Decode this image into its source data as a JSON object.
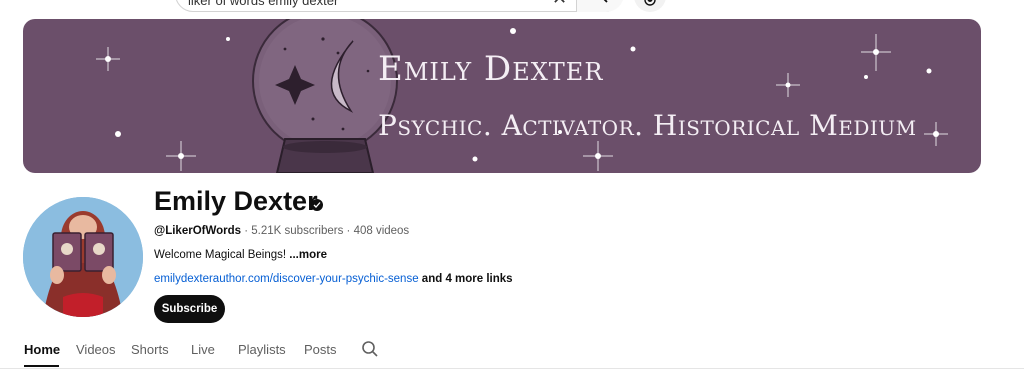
{
  "search": {
    "query": "liker of words emily dexter",
    "clear_icon": "close-icon",
    "button_icon": "search-icon",
    "mic_icon": "mic-icon"
  },
  "banner": {
    "title": "Emily Dexter",
    "subtitle": "Psychic. Activator. Historical Medium",
    "background_color": "#6b4f6a"
  },
  "channel": {
    "name": "Emily Dexter",
    "verified_icon": "verified-check-icon",
    "handle": "@LikerOfWords",
    "subscribers": "5.21K subscribers",
    "videos": "408 videos",
    "separator": " · ",
    "description": "Welcome Magical Beings! ",
    "more_label": "...more",
    "link": "emilydexterauthor.com/discover-your-psychic-sense",
    "more_links": " and 4 more links",
    "subscribe_label": "Subscribe"
  },
  "tabs": [
    {
      "label": "Home",
      "active": true
    },
    {
      "label": "Videos",
      "active": false
    },
    {
      "label": "Shorts",
      "active": false
    },
    {
      "label": "Live",
      "active": false
    },
    {
      "label": "Playlists",
      "active": false
    },
    {
      "label": "Posts",
      "active": false
    }
  ],
  "tabs_search_icon": "search-icon",
  "colors": {
    "link": "#065fd4",
    "text": "#0f0f0f",
    "secondary_text": "#606060"
  }
}
